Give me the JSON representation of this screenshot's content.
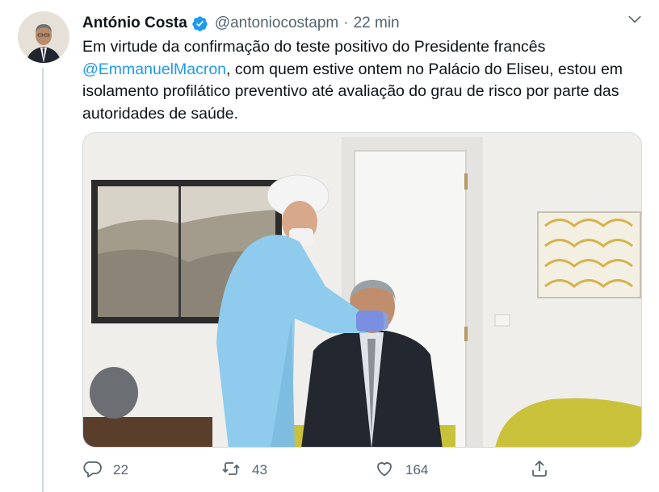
{
  "tweet": {
    "author_name": "António Costa",
    "handle": "@antoniocostapm",
    "separator": "·",
    "time": "22 min",
    "text_part1": "Em virtude da confirmação do teste positivo do Presidente francês",
    "mention": "@EmmanuelMacron",
    "text_part2": ", com quem estive ontem no Palácio do Eliseu, estou em isolamento profilático preventivo até avaliação do grau de risco por parte das autoridades de saúde."
  },
  "actions": {
    "reply_count": "22",
    "retweet_count": "43",
    "like_count": "164"
  },
  "icons": {
    "verified": "verified-badge-icon",
    "caret": "chevron-down-icon",
    "reply": "reply-icon",
    "retweet": "retweet-icon",
    "like": "heart-icon",
    "share": "share-icon"
  },
  "colors": {
    "accent": "#1d9bf0",
    "text": "#0f1419",
    "secondary": "#536471"
  }
}
